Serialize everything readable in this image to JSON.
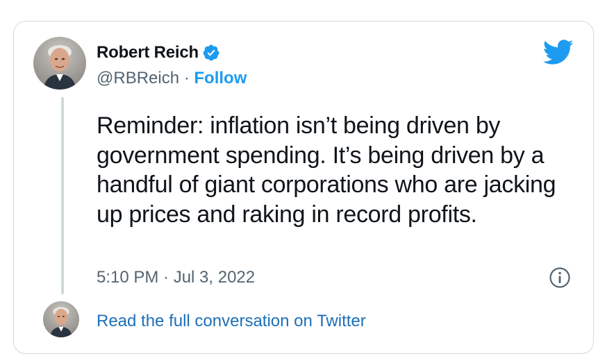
{
  "tweet": {
    "author_name": "Robert Reich",
    "handle": "@RBReich",
    "separator": " · ",
    "follow_label": "Follow",
    "text": "Reminder: inflation isn’t being driven by government spending. It’s being driven by a handful of giant corporations who are jacking up prices and raking in record profits.",
    "timestamp": "5:10 PM · Jul 3, 2022",
    "read_full_label": "Read the full conversation on Twitter"
  },
  "icons": {
    "verified": "verified-badge-icon",
    "brand": "twitter-bird-icon",
    "info": "info-icon"
  },
  "colors": {
    "twitter_blue": "#1d9bf0",
    "text_primary": "#0f1419",
    "text_secondary": "#536471",
    "link": "#1d6fb8",
    "border": "#d4d9dd"
  }
}
